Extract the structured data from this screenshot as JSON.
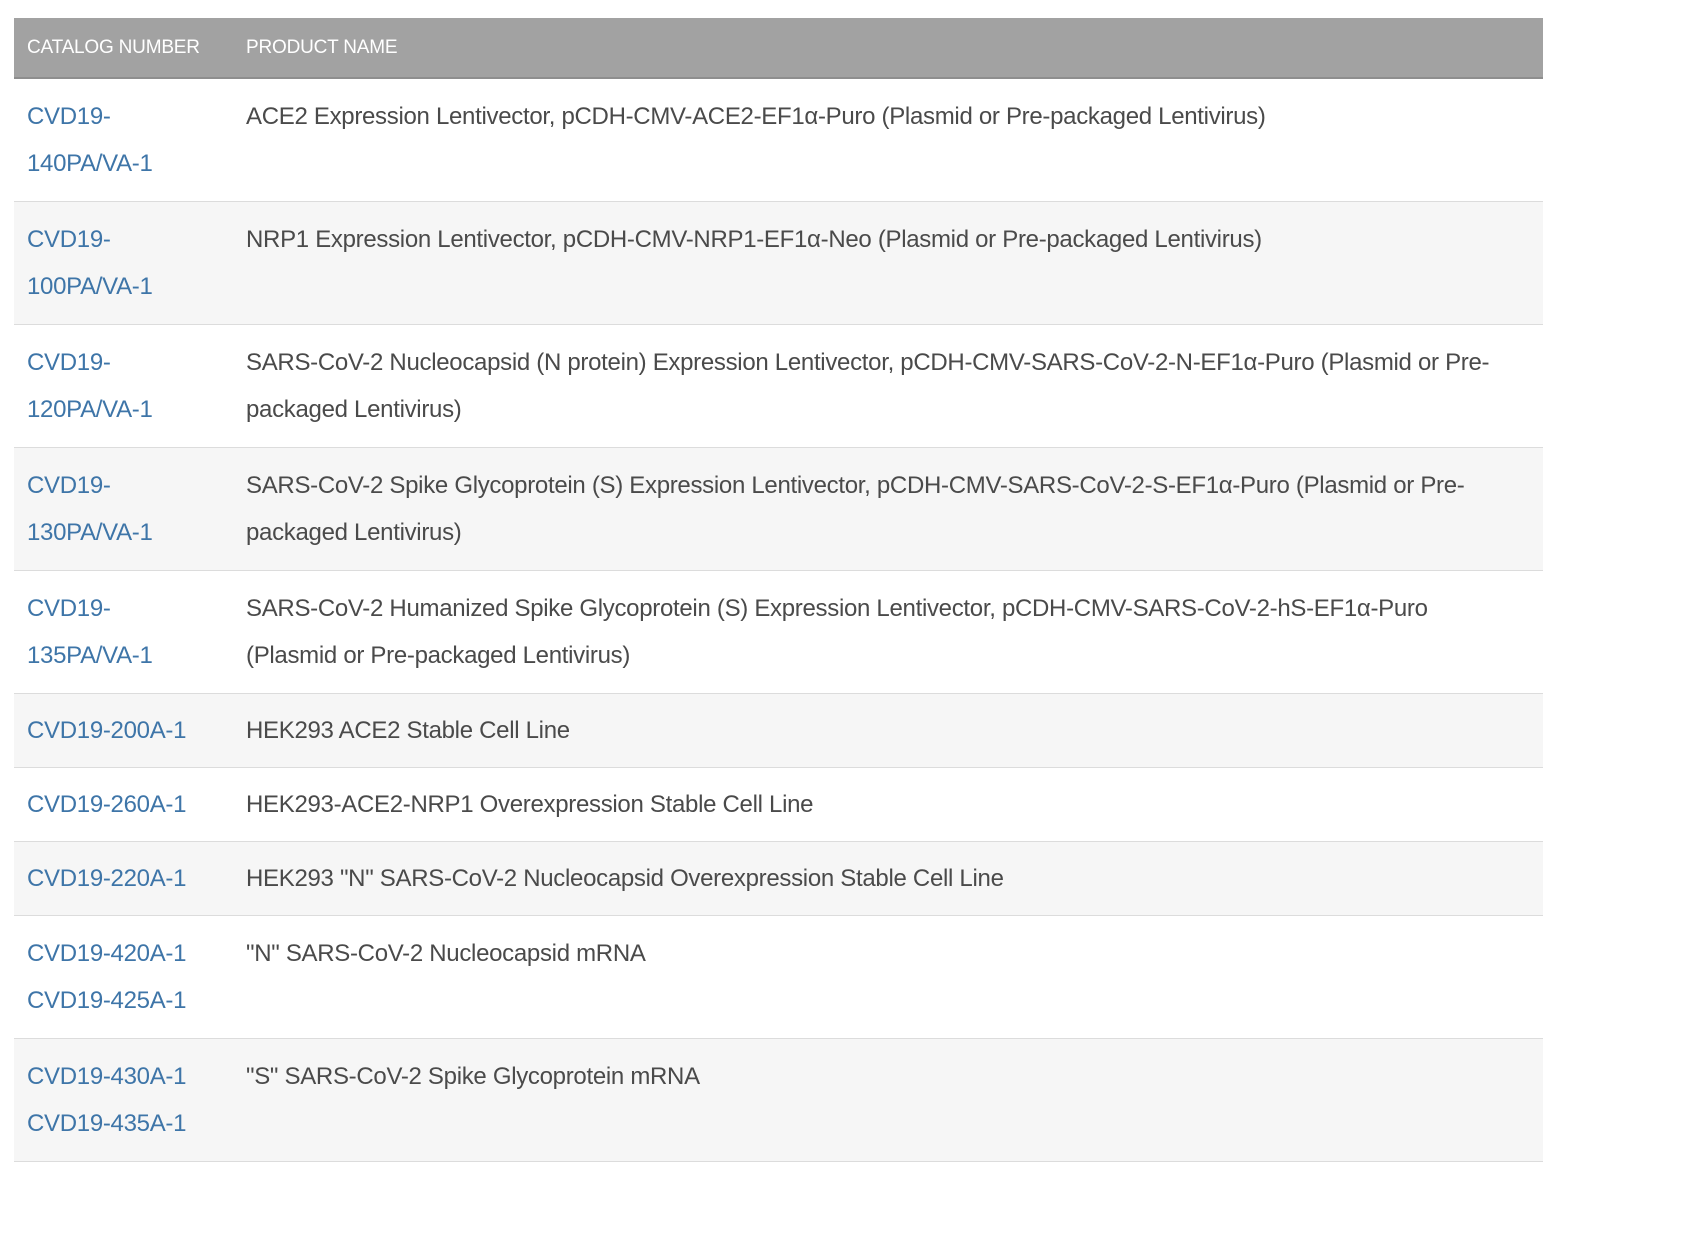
{
  "table": {
    "headers": {
      "catalog": "CATALOG NUMBER",
      "product": "PRODUCT NAME"
    },
    "rows": [
      {
        "catalog": [
          "CVD19-140PA/VA-1"
        ],
        "product": "ACE2 Expression Lentivector, pCDH-CMV-ACE2-EF1α-Puro (Plasmid or Pre-packaged Lentivirus)"
      },
      {
        "catalog": [
          "CVD19-100PA/VA-1"
        ],
        "product": "NRP1 Expression Lentivector, pCDH-CMV-NRP1-EF1α-Neo (Plasmid or Pre-packaged Lentivirus)"
      },
      {
        "catalog": [
          "CVD19-120PA/VA-1"
        ],
        "product": "SARS-CoV-2 Nucleocapsid (N protein) Expression Lentivector, pCDH-CMV-SARS-CoV-2-N-EF1α-Puro (Plasmid or Pre-packaged Lentivirus)"
      },
      {
        "catalog": [
          "CVD19-130PA/VA-1"
        ],
        "product": "SARS-CoV-2 Spike Glycoprotein (S) Expression Lentivector, pCDH-CMV-SARS-CoV-2-S-EF1α-Puro (Plasmid or Pre-packaged Lentivirus)"
      },
      {
        "catalog": [
          "CVD19-135PA/VA-1"
        ],
        "product": "SARS-CoV-2 Humanized Spike Glycoprotein (S) Expression Lentivector, pCDH-CMV-SARS-CoV-2-hS-EF1α-Puro (Plasmid or Pre-packaged Lentivirus)"
      },
      {
        "catalog": [
          "CVD19-200A-1"
        ],
        "product": "HEK293 ACE2 Stable Cell Line"
      },
      {
        "catalog": [
          "CVD19-260A-1"
        ],
        "product": "HEK293-ACE2-NRP1 Overexpression Stable Cell Line"
      },
      {
        "catalog": [
          "CVD19-220A-1"
        ],
        "product": "HEK293 \"N\" SARS-CoV-2 Nucleocapsid Overexpression Stable Cell Line"
      },
      {
        "catalog": [
          "CVD19-420A-1",
          "CVD19-425A-1"
        ],
        "product": "\"N\" SARS-CoV-2 Nucleocapsid mRNA"
      },
      {
        "catalog": [
          "CVD19-430A-1",
          "CVD19-435A-1"
        ],
        "product": "\"S\" SARS-CoV-2 Spike Glycoprotein mRNA"
      }
    ]
  },
  "colors": {
    "header_bg": "#a2a2a2",
    "link": "#3e75a8",
    "text": "#4a4a4a",
    "row_alt": "#f6f6f6"
  }
}
